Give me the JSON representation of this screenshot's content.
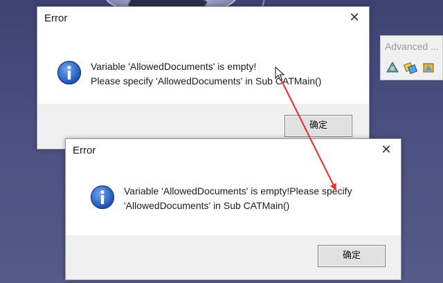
{
  "background": {
    "toolbar": {
      "title": "Advanced ..."
    }
  },
  "dialogs": [
    {
      "title": "Error",
      "close_glyph": "✕",
      "icon": "info-icon",
      "message_lines": [
        "Variable 'AllowedDocuments' is empty!",
        "Please specify 'AllowedDocuments' in Sub CATMain()"
      ],
      "ok_label": "确定"
    },
    {
      "title": "Error",
      "close_glyph": "✕",
      "icon": "info-icon",
      "message_lines": [
        "Variable 'AllowedDocuments' is empty!Please specify",
        "'AllowedDocuments' in Sub CATMain()"
      ],
      "ok_label": "确定"
    }
  ],
  "colors": {
    "annotation_arrow": "#e53935",
    "info_blue": "#1f5fbf",
    "viewport_bg": "#454a7a"
  }
}
